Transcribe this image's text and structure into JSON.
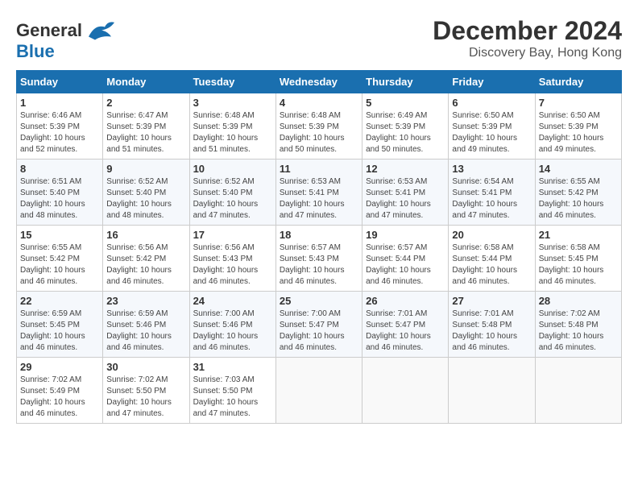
{
  "logo": {
    "line1": "General",
    "line2": "Blue",
    "bird_color": "#1a6faf"
  },
  "title": {
    "month": "December 2024",
    "location": "Discovery Bay, Hong Kong"
  },
  "days_of_week": [
    "Sunday",
    "Monday",
    "Tuesday",
    "Wednesday",
    "Thursday",
    "Friday",
    "Saturday"
  ],
  "weeks": [
    [
      {
        "day": "1",
        "sunrise": "6:46 AM",
        "sunset": "5:39 PM",
        "daylight": "10 hours and 52 minutes."
      },
      {
        "day": "2",
        "sunrise": "6:47 AM",
        "sunset": "5:39 PM",
        "daylight": "10 hours and 51 minutes."
      },
      {
        "day": "3",
        "sunrise": "6:48 AM",
        "sunset": "5:39 PM",
        "daylight": "10 hours and 51 minutes."
      },
      {
        "day": "4",
        "sunrise": "6:48 AM",
        "sunset": "5:39 PM",
        "daylight": "10 hours and 50 minutes."
      },
      {
        "day": "5",
        "sunrise": "6:49 AM",
        "sunset": "5:39 PM",
        "daylight": "10 hours and 50 minutes."
      },
      {
        "day": "6",
        "sunrise": "6:50 AM",
        "sunset": "5:39 PM",
        "daylight": "10 hours and 49 minutes."
      },
      {
        "day": "7",
        "sunrise": "6:50 AM",
        "sunset": "5:39 PM",
        "daylight": "10 hours and 49 minutes."
      }
    ],
    [
      {
        "day": "8",
        "sunrise": "6:51 AM",
        "sunset": "5:40 PM",
        "daylight": "10 hours and 48 minutes."
      },
      {
        "day": "9",
        "sunrise": "6:52 AM",
        "sunset": "5:40 PM",
        "daylight": "10 hours and 48 minutes."
      },
      {
        "day": "10",
        "sunrise": "6:52 AM",
        "sunset": "5:40 PM",
        "daylight": "10 hours and 47 minutes."
      },
      {
        "day": "11",
        "sunrise": "6:53 AM",
        "sunset": "5:41 PM",
        "daylight": "10 hours and 47 minutes."
      },
      {
        "day": "12",
        "sunrise": "6:53 AM",
        "sunset": "5:41 PM",
        "daylight": "10 hours and 47 minutes."
      },
      {
        "day": "13",
        "sunrise": "6:54 AM",
        "sunset": "5:41 PM",
        "daylight": "10 hours and 47 minutes."
      },
      {
        "day": "14",
        "sunrise": "6:55 AM",
        "sunset": "5:42 PM",
        "daylight": "10 hours and 46 minutes."
      }
    ],
    [
      {
        "day": "15",
        "sunrise": "6:55 AM",
        "sunset": "5:42 PM",
        "daylight": "10 hours and 46 minutes."
      },
      {
        "day": "16",
        "sunrise": "6:56 AM",
        "sunset": "5:42 PM",
        "daylight": "10 hours and 46 minutes."
      },
      {
        "day": "17",
        "sunrise": "6:56 AM",
        "sunset": "5:43 PM",
        "daylight": "10 hours and 46 minutes."
      },
      {
        "day": "18",
        "sunrise": "6:57 AM",
        "sunset": "5:43 PM",
        "daylight": "10 hours and 46 minutes."
      },
      {
        "day": "19",
        "sunrise": "6:57 AM",
        "sunset": "5:44 PM",
        "daylight": "10 hours and 46 minutes."
      },
      {
        "day": "20",
        "sunrise": "6:58 AM",
        "sunset": "5:44 PM",
        "daylight": "10 hours and 46 minutes."
      },
      {
        "day": "21",
        "sunrise": "6:58 AM",
        "sunset": "5:45 PM",
        "daylight": "10 hours and 46 minutes."
      }
    ],
    [
      {
        "day": "22",
        "sunrise": "6:59 AM",
        "sunset": "5:45 PM",
        "daylight": "10 hours and 46 minutes."
      },
      {
        "day": "23",
        "sunrise": "6:59 AM",
        "sunset": "5:46 PM",
        "daylight": "10 hours and 46 minutes."
      },
      {
        "day": "24",
        "sunrise": "7:00 AM",
        "sunset": "5:46 PM",
        "daylight": "10 hours and 46 minutes."
      },
      {
        "day": "25",
        "sunrise": "7:00 AM",
        "sunset": "5:47 PM",
        "daylight": "10 hours and 46 minutes."
      },
      {
        "day": "26",
        "sunrise": "7:01 AM",
        "sunset": "5:47 PM",
        "daylight": "10 hours and 46 minutes."
      },
      {
        "day": "27",
        "sunrise": "7:01 AM",
        "sunset": "5:48 PM",
        "daylight": "10 hours and 46 minutes."
      },
      {
        "day": "28",
        "sunrise": "7:02 AM",
        "sunset": "5:48 PM",
        "daylight": "10 hours and 46 minutes."
      }
    ],
    [
      {
        "day": "29",
        "sunrise": "7:02 AM",
        "sunset": "5:49 PM",
        "daylight": "10 hours and 46 minutes."
      },
      {
        "day": "30",
        "sunrise": "7:02 AM",
        "sunset": "5:50 PM",
        "daylight": "10 hours and 47 minutes."
      },
      {
        "day": "31",
        "sunrise": "7:03 AM",
        "sunset": "5:50 PM",
        "daylight": "10 hours and 47 minutes."
      },
      null,
      null,
      null,
      null
    ]
  ],
  "labels": {
    "sunrise": "Sunrise:",
    "sunset": "Sunset:",
    "daylight": "Daylight:"
  }
}
